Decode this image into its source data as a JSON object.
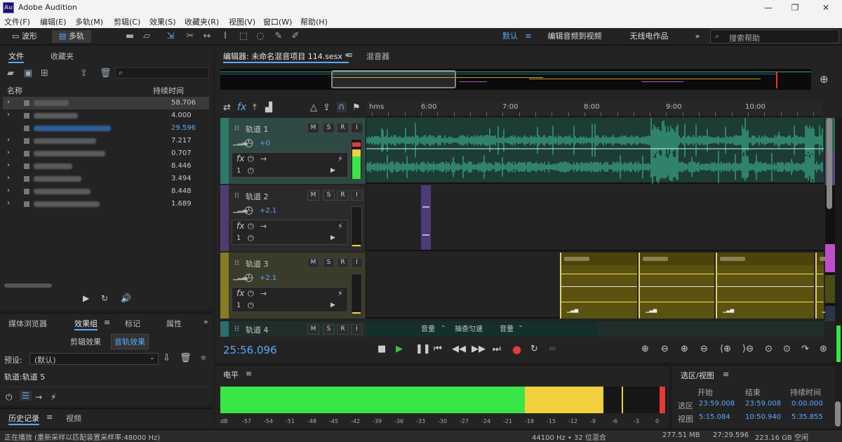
{
  "window": {
    "title": "Adobe Audition",
    "app_icon": "Au",
    "minimize": "—",
    "maximize": "❐",
    "close": "✕"
  },
  "menu": [
    "文件(F)",
    "编辑(E)",
    "多轨(M)",
    "剪辑(C)",
    "效果(S)",
    "收藏夹(R)",
    "视图(V)",
    "窗口(W)",
    "帮助(H)"
  ],
  "toolbar": {
    "waveform": "波形",
    "multitrack": "多轨",
    "workspaces": [
      "默认",
      "编辑音频到视频",
      "无线电作品"
    ],
    "search_placeholder": "搜索帮助",
    "more": "»"
  },
  "files_panel": {
    "tabs": [
      "文件",
      "收藏夹"
    ],
    "col_name": "名称",
    "col_duration": "持续时间",
    "rows": [
      {
        "duration": "58.706",
        "expand": true
      },
      {
        "duration": "4.000",
        "expand": true
      },
      {
        "duration": "29.596",
        "expand": false,
        "highlight": true
      },
      {
        "duration": "7.217",
        "expand": true
      },
      {
        "duration": "0.707",
        "expand": true
      },
      {
        "duration": "8.446",
        "expand": true
      },
      {
        "duration": "3.494",
        "expand": true
      },
      {
        "duration": "8.448",
        "expand": true
      },
      {
        "duration": "1.689",
        "expand": true
      }
    ]
  },
  "effects_panel": {
    "tabs": [
      "媒体浏览器",
      "效果组",
      "标记",
      "属性"
    ],
    "subtabs": [
      "剪辑效果",
      "音轨效果"
    ],
    "preset_label": "预设:",
    "preset_value": "(默认)",
    "track_label": "轨道:轨道 5"
  },
  "history_panel": {
    "tabs": [
      "历史记录",
      "视频"
    ]
  },
  "editor": {
    "tabs": [
      "编辑器: 未命名混音项目 114.sesx *",
      "混音器"
    ],
    "timecode": "25:56.096"
  },
  "ruler": {
    "unit": "hms",
    "ticks": [
      "6:00",
      "7:00",
      "8:00",
      "9:00",
      "10:00"
    ]
  },
  "tracks": [
    {
      "name": "轨道 1",
      "volume": "+0",
      "color": "#2ea38a",
      "bg": "#1c3c34",
      "fx_index": "1"
    },
    {
      "name": "轨道 2",
      "volume": "+2.1",
      "color": "#6e4aa8",
      "bg": "#2a2a2a",
      "fx_index": "1"
    },
    {
      "name": "轨道 3",
      "volume": "+2.1",
      "color": "#c8b21e",
      "bg": "#4d4410",
      "fx_index": "1"
    },
    {
      "name": "轨道 4"
    }
  ],
  "track4_controls": {
    "volume": "音量",
    "flatten": "抽查匀速",
    "volume2": "音量"
  },
  "track_buttons": {
    "m": "M",
    "s": "S",
    "r": "R",
    "i": "I"
  },
  "level_panel": {
    "title": "电平",
    "scale": [
      "dB",
      "-57",
      "-54",
      "-51",
      "-48",
      "-45",
      "-42",
      "-39",
      "-36",
      "-33",
      "-30",
      "-27",
      "-24",
      "-21",
      "-18",
      "-15",
      "-12",
      "-9",
      "-6",
      "-3",
      "0"
    ]
  },
  "selection_panel": {
    "title": "选区/视图",
    "headers": [
      "开始",
      "结束",
      "持续时间"
    ],
    "rows": [
      {
        "label": "选区",
        "start": "23:59.008",
        "end": "23:59.008",
        "duration": "0:00.000"
      },
      {
        "label": "视图",
        "start": "5:15.084",
        "end": "10:50.940",
        "duration": "5:35.855"
      }
    ]
  },
  "status": {
    "left": "正在播放  (重新采样以匹配装置采样率:48000 Hz)",
    "rate": "44100 Hz • 32 位混合",
    "mem": "277.51 MB",
    "time": "27:29.596",
    "disk": "223.16 GB 空闲"
  },
  "colors": {
    "accent": "#5aa9ff",
    "level_green": "#38e645",
    "level_yellow": "#f2cf3c",
    "level_red": "#e63a3a"
  }
}
